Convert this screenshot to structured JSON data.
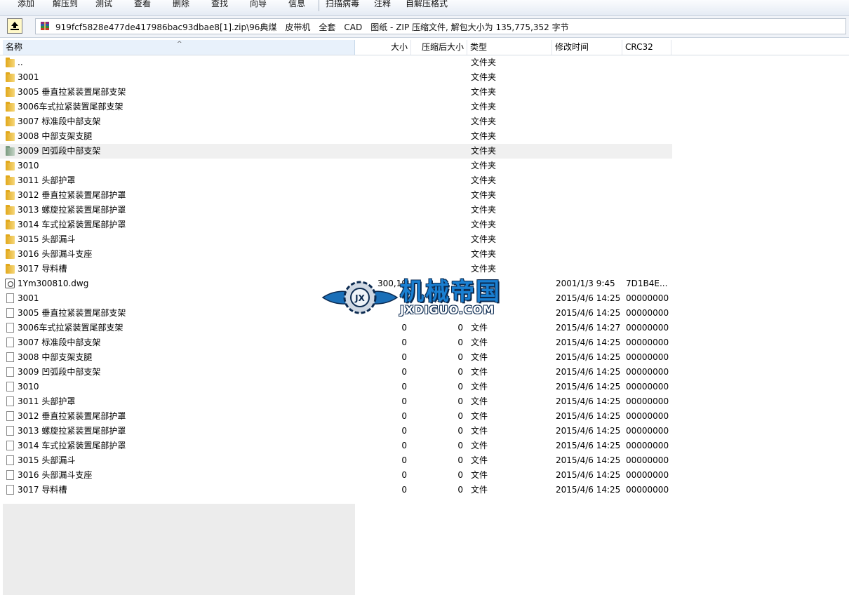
{
  "toolbar": {
    "add": "添加",
    "extract": "解压到",
    "test": "测试",
    "view": "查看",
    "delete": "删除",
    "find": "查找",
    "wizard": "向导",
    "info": "信息",
    "scan": "扫描病毒",
    "comment": "注释",
    "sfx": "自解压格式"
  },
  "address": {
    "path": "919fcf5828e477de417986bac93dbae8[1].zip\\96典煤　皮带机　全套　CAD　图纸 - ZIP 压缩文件, 解包大小为 135,775,352 字节"
  },
  "columns": {
    "name": "名称",
    "size": "大小",
    "packed": "压缩后大小",
    "type": "类型",
    "modified": "修改时间",
    "crc": "CRC32"
  },
  "rows": [
    {
      "icon": "folder-icon",
      "name": "..",
      "size": "",
      "packed": "",
      "type": "文件夹",
      "modified": "",
      "crc": ""
    },
    {
      "icon": "folder-icon",
      "name": "3001",
      "size": "",
      "packed": "",
      "type": "文件夹",
      "modified": "",
      "crc": ""
    },
    {
      "icon": "folder-icon",
      "name": "3005 垂直拉紧装置尾部支架",
      "size": "",
      "packed": "",
      "type": "文件夹",
      "modified": "",
      "crc": ""
    },
    {
      "icon": "folder-icon",
      "name": "3006车式拉紧装置尾部支架",
      "size": "",
      "packed": "",
      "type": "文件夹",
      "modified": "",
      "crc": ""
    },
    {
      "icon": "folder-icon",
      "name": "3007 标准段中部支架",
      "size": "",
      "packed": "",
      "type": "文件夹",
      "modified": "",
      "crc": ""
    },
    {
      "icon": "folder-icon",
      "name": "3008 中部支架支腿",
      "size": "",
      "packed": "",
      "type": "文件夹",
      "modified": "",
      "crc": ""
    },
    {
      "icon": "folder-icon",
      "name": "3009 凹弧段中部支架",
      "size": "",
      "packed": "",
      "type": "文件夹",
      "modified": "",
      "crc": "",
      "highlight": true
    },
    {
      "icon": "folder-icon",
      "name": "3010",
      "size": "",
      "packed": "",
      "type": "文件夹",
      "modified": "",
      "crc": ""
    },
    {
      "icon": "folder-icon",
      "name": "3011 头部护罩",
      "size": "",
      "packed": "",
      "type": "文件夹",
      "modified": "",
      "crc": ""
    },
    {
      "icon": "folder-icon",
      "name": "3012 垂直拉紧装置尾部护罩",
      "size": "",
      "packed": "",
      "type": "文件夹",
      "modified": "",
      "crc": ""
    },
    {
      "icon": "folder-icon",
      "name": "3013 螺旋拉紧装置尾部护罩",
      "size": "",
      "packed": "",
      "type": "文件夹",
      "modified": "",
      "crc": ""
    },
    {
      "icon": "folder-icon",
      "name": "3014 车式拉紧装置尾部护罩",
      "size": "",
      "packed": "",
      "type": "文件夹",
      "modified": "",
      "crc": ""
    },
    {
      "icon": "folder-icon",
      "name": "3015 头部漏斗",
      "size": "",
      "packed": "",
      "type": "文件夹",
      "modified": "",
      "crc": ""
    },
    {
      "icon": "folder-icon",
      "name": "3016 头部漏斗支座",
      "size": "",
      "packed": "",
      "type": "文件夹",
      "modified": "",
      "crc": ""
    },
    {
      "icon": "folder-icon",
      "name": "3017 导料槽",
      "size": "",
      "packed": "",
      "type": "文件夹",
      "modified": "",
      "crc": ""
    },
    {
      "icon": "dwg-icon",
      "name": "1Ym300810.dwg",
      "size": "300,19",
      "packed": "",
      "type": "",
      "modified": "2001/1/3 9:45",
      "crc": "7D1B4E..."
    },
    {
      "icon": "file-icon",
      "name": "3001",
      "size": "",
      "packed": "",
      "type": "",
      "modified": "2015/4/6 14:25",
      "crc": "00000000"
    },
    {
      "icon": "file-icon",
      "name": "3005 垂直拉紧装置尾部支架",
      "size": "",
      "packed": "",
      "type": "",
      "modified": "2015/4/6 14:25",
      "crc": "00000000"
    },
    {
      "icon": "file-icon",
      "name": "3006车式拉紧装置尾部支架",
      "size": "0",
      "packed": "0",
      "type": "文件",
      "modified": "2015/4/6 14:27",
      "crc": "00000000"
    },
    {
      "icon": "file-icon",
      "name": "3007 标准段中部支架",
      "size": "0",
      "packed": "0",
      "type": "文件",
      "modified": "2015/4/6 14:25",
      "crc": "00000000"
    },
    {
      "icon": "file-icon",
      "name": "3008 中部支架支腿",
      "size": "0",
      "packed": "0",
      "type": "文件",
      "modified": "2015/4/6 14:25",
      "crc": "00000000"
    },
    {
      "icon": "file-icon",
      "name": "3009 凹弧段中部支架",
      "size": "0",
      "packed": "0",
      "type": "文件",
      "modified": "2015/4/6 14:25",
      "crc": "00000000"
    },
    {
      "icon": "file-icon",
      "name": "3010",
      "size": "0",
      "packed": "0",
      "type": "文件",
      "modified": "2015/4/6 14:25",
      "crc": "00000000"
    },
    {
      "icon": "file-icon",
      "name": "3011 头部护罩",
      "size": "0",
      "packed": "0",
      "type": "文件",
      "modified": "2015/4/6 14:25",
      "crc": "00000000"
    },
    {
      "icon": "file-icon",
      "name": "3012 垂直拉紧装置尾部护罩",
      "size": "0",
      "packed": "0",
      "type": "文件",
      "modified": "2015/4/6 14:25",
      "crc": "00000000"
    },
    {
      "icon": "file-icon",
      "name": "3013 螺旋拉紧装置尾部护罩",
      "size": "0",
      "packed": "0",
      "type": "文件",
      "modified": "2015/4/6 14:25",
      "crc": "00000000"
    },
    {
      "icon": "file-icon",
      "name": "3014 车式拉紧装置尾部护罩",
      "size": "0",
      "packed": "0",
      "type": "文件",
      "modified": "2015/4/6 14:25",
      "crc": "00000000"
    },
    {
      "icon": "file-icon",
      "name": "3015 头部漏斗",
      "size": "0",
      "packed": "0",
      "type": "文件",
      "modified": "2015/4/6 14:25",
      "crc": "00000000"
    },
    {
      "icon": "file-icon",
      "name": "3016 头部漏斗支座",
      "size": "0",
      "packed": "0",
      "type": "文件",
      "modified": "2015/4/6 14:25",
      "crc": "00000000"
    },
    {
      "icon": "file-icon",
      "name": "3017 导料槽",
      "size": "0",
      "packed": "0",
      "type": "文件",
      "modified": "2015/4/6 14:25",
      "crc": "00000000"
    }
  ],
  "watermark": {
    "title": "机械帝国",
    "subtitle": "JXDIGUO.COM"
  }
}
